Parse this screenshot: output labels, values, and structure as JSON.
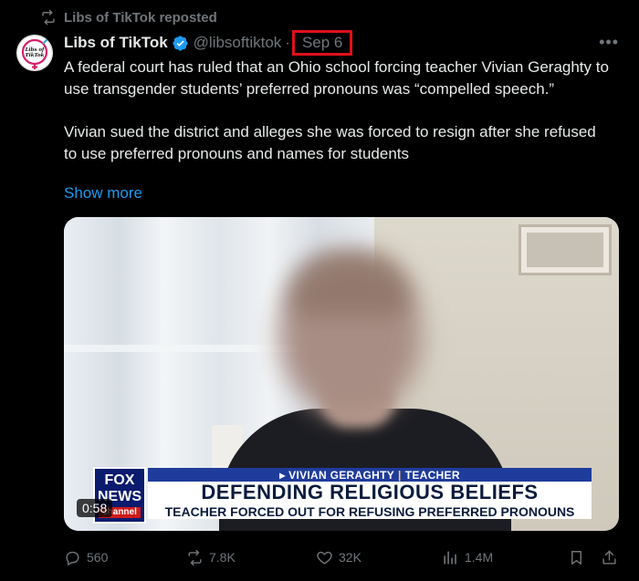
{
  "repost": {
    "label": "Libs of TikTok reposted",
    "icon": "repost-icon"
  },
  "author": {
    "avatar_text": "Libs of TikTok",
    "name": "Libs of TikTok",
    "handle": "@libsoftiktok",
    "separator": "·",
    "date": "Sep 6",
    "verified_color": "#1d9bf0"
  },
  "tweet": {
    "paragraph1": "A federal court has ruled that an Ohio school forcing teacher Vivian Geraghty to use transgender students’ preferred pronouns was “compelled speech.”",
    "paragraph2": "Vivian sued the district and alleges she was forced to resign after she refused to use preferred pronouns and names for students",
    "show_more": "Show more"
  },
  "video": {
    "logo_line1": "FOX",
    "logo_line2": "NEWS",
    "logo_channel": "channel",
    "chyron_name": "▸ VIVIAN GERAGHTY",
    "chyron_divider": "|",
    "chyron_role": "TEACHER",
    "chyron_headline": "DEFENDING RELIGIOUS BELIEFS",
    "chyron_subhead": "TEACHER FORCED OUT FOR REFUSING PREFERRED PRONOUNS",
    "duration": "0:58"
  },
  "actions": {
    "replies": "560",
    "reposts": "7.8K",
    "likes": "32K",
    "views": "1.4M"
  },
  "colors": {
    "accent": "#1d9bf0",
    "muted": "#71767b",
    "highlight_box": "#e0101a"
  }
}
